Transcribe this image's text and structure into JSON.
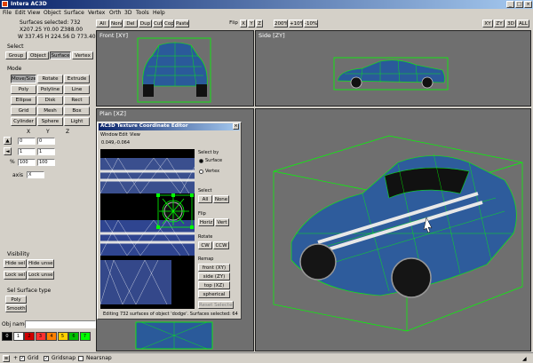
{
  "window": {
    "title": "Intera AC3D"
  },
  "menu": [
    "File",
    "Edit",
    "View",
    "Object",
    "Surface",
    "Vertex",
    "Orth",
    "3D",
    "Tools",
    "Help"
  ],
  "status": {
    "surfaces": "Surfaces selected: 732",
    "line1": "X207.25 Y0.00 Z388.00",
    "line2": "W 337.45 H 224.56 D 773.40"
  },
  "toolbar": {
    "buttons": [
      "All",
      "None",
      "Del",
      "Dup",
      "Cut",
      "Copy",
      "Paste"
    ],
    "flip": "Flip",
    "axes": [
      "X",
      "Y",
      "Z"
    ],
    "pct": [
      "200%",
      "+10%",
      "-10%"
    ],
    "views": [
      "XY",
      "ZY",
      "3D",
      "ALL"
    ]
  },
  "select": {
    "title": "Select",
    "tabs": [
      "Group",
      "Object",
      "Surface",
      "Vertex"
    ]
  },
  "mode": {
    "title": "Mode",
    "buttons": [
      [
        "Move/Size",
        "Rotate",
        "Extrude"
      ],
      [
        "Poly",
        "Polyline",
        "Line"
      ],
      [
        "Ellipse",
        "Disk",
        "Rect"
      ],
      [
        "Grid",
        "Mesh",
        "Box"
      ],
      [
        "Cylinder",
        "Sphere",
        "Light"
      ]
    ]
  },
  "axes_panel": {
    "x": "X",
    "y": "Y",
    "z": "Z",
    "vals": [
      "0",
      "0",
      "1",
      "1",
      "100",
      "100"
    ],
    "axis_label": "axis",
    "axis_val": "X"
  },
  "visibility": {
    "title": "Visibility",
    "b1": "Hide sel",
    "b2": "Hide unsel",
    "b3": "Lock sel",
    "b4": "Lock unsel"
  },
  "sel_surface": {
    "title": "Sel Surface type",
    "poly": "Poly",
    "smooth": "Smooth"
  },
  "obj_name": "Obj name:",
  "palette": [
    "#000000",
    "#ffffff",
    "#d00000",
    "#ff3030",
    "#ff8000",
    "#ffd000",
    "#00c000",
    "#00ff00"
  ],
  "palette_nums": [
    "0",
    "1",
    "2",
    "3",
    "4",
    "5",
    "6",
    "7"
  ],
  "bottom": {
    "grid": "Grid",
    "gridsnap": "Gridsnap",
    "nearsnap": "Nearsnap"
  },
  "viewports": {
    "front": "Front [XY]",
    "side": "Side [ZY]",
    "plan": "Plan [XZ]"
  },
  "tex": {
    "title": "AC3D Texture Coordinate Editor",
    "menu": [
      "Window",
      "Edit",
      "View"
    ],
    "coords": "0.049,-0.064",
    "select_by": "Select by",
    "surface": "Surface",
    "vertex": "Vertex",
    "select": "Select",
    "all": "All",
    "none": "None",
    "flip": "Flip",
    "horiz": "Horiz",
    "vert": "Vert",
    "rotate": "Rotate",
    "cw": "CW",
    "ccw": "CCW",
    "remap": "Remap",
    "remap_opts": [
      "front (XY)",
      "side (ZY)",
      "top (XZ)",
      "spherical"
    ],
    "reset": "Reset Selected",
    "status": "Editing 732 surfaces of object 'dodge'. Surfaces selected: 64"
  }
}
